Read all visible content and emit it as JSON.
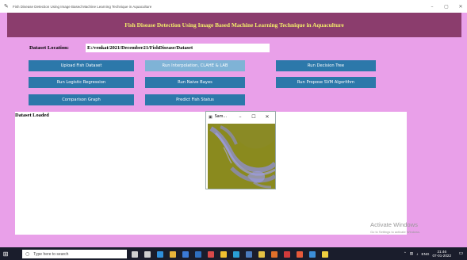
{
  "window": {
    "title": "Fish Disease Detection Using Image Based Machine Learning Technique in Aquaculture",
    "minimize": "–",
    "maximize": "▢",
    "close": "✕"
  },
  "banner": {
    "text": "Fish Disease Detection Using Image Based Machine Learning Technique in Aquaculture"
  },
  "dataset": {
    "label": "Dataset Location:",
    "path": "E:/venkat/2021/December21/FishDisease/Dataset"
  },
  "buttons": {
    "upload": "Upload Fish Dataset",
    "interp": "Run Interpolation, CLAHE & LAB",
    "dtree": "Run Decision Tree",
    "logreg": "Run Logistic Regression",
    "nbayes": "Run Naive Bayes",
    "svm": "Run Propose SVM Algorithm",
    "compare": "Comparison Graph",
    "predict": "Predict Fish Status"
  },
  "output": {
    "text": "Dataset Loaded"
  },
  "popup": {
    "title": "Sam...",
    "minimize": "–",
    "maximize": "☐",
    "close": "✕"
  },
  "watermark": {
    "line1": "Activate Windows",
    "line2": "Go to Settings to activate Windows."
  },
  "taskbar": {
    "search_placeholder": "Type here to search",
    "time": "21:46",
    "date": "07-01-2022",
    "lang": "ENG",
    "icons": [
      {
        "name": "cortana-icon",
        "color": "#cfcfcf"
      },
      {
        "name": "task-view-icon",
        "color": "#cfcfcf"
      },
      {
        "name": "edge-icon",
        "color": "#2f8fdc"
      },
      {
        "name": "explorer-icon",
        "color": "#e8b43a"
      },
      {
        "name": "store-icon",
        "color": "#3b7ad6"
      },
      {
        "name": "mail-icon",
        "color": "#2f6fbf"
      },
      {
        "name": "app-icon",
        "color": "#d94a4a"
      },
      {
        "name": "notes-icon",
        "color": "#f0c030"
      },
      {
        "name": "calendar-icon",
        "color": "#2aa0d6"
      },
      {
        "name": "terminal-icon",
        "color": "#4b7bbd"
      },
      {
        "name": "chrome-icon",
        "color": "#e4c144"
      },
      {
        "name": "firefox-icon",
        "color": "#e0702a"
      },
      {
        "name": "pdf-icon",
        "color": "#d23b3b"
      },
      {
        "name": "media-icon",
        "color": "#e65a3a"
      },
      {
        "name": "photos-icon",
        "color": "#3c8ed8"
      },
      {
        "name": "python-icon",
        "color": "#f0d040"
      }
    ]
  }
}
